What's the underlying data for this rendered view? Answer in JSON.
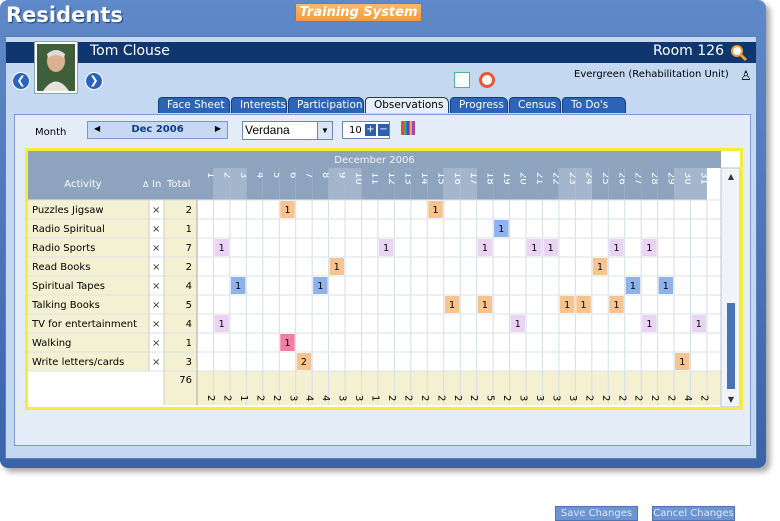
{
  "app": {
    "title": "Residents",
    "badge": "Training System"
  },
  "resident": {
    "name": "Tom Clouse",
    "room": "Room 126",
    "unit": "Evergreen (Rehabilitation Unit)"
  },
  "tabs": [
    "Face Sheet",
    "Interests",
    "Participation",
    "Observations",
    "Progress",
    "Census",
    "To Do's"
  ],
  "active_tab": "Observations",
  "controls": {
    "month_label": "Month",
    "month_value": "Dec 2006",
    "font": "Verdana",
    "size": "10"
  },
  "grid": {
    "banner": "December 2006",
    "col_activity": "Activity",
    "col_in": "In",
    "col_total": "Total",
    "days": [
      "1",
      "2",
      "3",
      "4",
      "5",
      "6",
      "7",
      "8",
      "9",
      "10",
      "11",
      "12",
      "13",
      "14",
      "15",
      "16",
      "17",
      "18",
      "19",
      "20",
      "21",
      "22",
      "23",
      "24",
      "25",
      "26",
      "27",
      "28",
      "29",
      "30",
      "31"
    ],
    "shaded_days": [
      2,
      3,
      9,
      10,
      16,
      17,
      23,
      24,
      30,
      31
    ],
    "rows": [
      {
        "activity": "Puzzles Jigsaw",
        "in": "×",
        "total": "2",
        "cells": [
          [
            6,
            "1",
            "#f6c48e"
          ],
          [
            15,
            "1",
            "#f6c48e"
          ]
        ]
      },
      {
        "activity": "Radio Spiritual",
        "in": "×",
        "total": "1",
        "cells": [
          [
            19,
            "1",
            "#8eb3ec"
          ]
        ]
      },
      {
        "activity": "Radio Sports",
        "in": "×",
        "total": "7",
        "cells": [
          [
            2,
            "1",
            "#ead4f4"
          ],
          [
            12,
            "1",
            "#ead4f4"
          ],
          [
            18,
            "1",
            "#ead4f4"
          ],
          [
            21,
            "1",
            "#ead4f4"
          ],
          [
            22,
            "1",
            "#ead4f4"
          ],
          [
            26,
            "1",
            "#ead4f4"
          ],
          [
            28,
            "1",
            "#ead4f4"
          ]
        ]
      },
      {
        "activity": "Read Books",
        "in": "×",
        "total": "2",
        "cells": [
          [
            9,
            "1",
            "#f6c48e"
          ],
          [
            25,
            "1",
            "#f6c48e"
          ]
        ]
      },
      {
        "activity": "Spiritual Tapes",
        "in": "×",
        "total": "4",
        "cells": [
          [
            3,
            "1",
            "#8eb3ec"
          ],
          [
            8,
            "1",
            "#8eb3ec"
          ],
          [
            27,
            "1",
            "#8eb3ec"
          ],
          [
            29,
            "1",
            "#8eb3ec"
          ]
        ]
      },
      {
        "activity": "Talking Books",
        "in": "×",
        "total": "5",
        "cells": [
          [
            16,
            "1",
            "#f6c48e"
          ],
          [
            18,
            "1",
            "#f6c48e"
          ],
          [
            23,
            "1",
            "#f6c48e"
          ],
          [
            24,
            "1",
            "#f6c48e"
          ],
          [
            26,
            "1",
            "#f6c48e"
          ]
        ]
      },
      {
        "activity": "TV for entertainment",
        "in": "×",
        "total": "4",
        "cells": [
          [
            2,
            "1",
            "#ead4f4"
          ],
          [
            20,
            "1",
            "#ead4f4"
          ],
          [
            28,
            "1",
            "#ead4f4"
          ],
          [
            31,
            "1",
            "#ead4f4"
          ]
        ]
      },
      {
        "activity": "Walking",
        "in": "×",
        "total": "1",
        "cells": [
          [
            6,
            "1",
            "#f27ea6"
          ]
        ]
      },
      {
        "activity": "Write letters/cards",
        "in": "×",
        "total": "3",
        "cells": [
          [
            7,
            "2",
            "#f6c48e"
          ],
          [
            30,
            "1",
            "#f6c48e"
          ]
        ]
      }
    ],
    "grand_total": "76",
    "day_totals": [
      "2",
      "2",
      "1",
      "2",
      "2",
      "3",
      "4",
      "4",
      "3",
      "3",
      "1",
      "2",
      "2",
      "2",
      "2",
      "2",
      "2",
      "5",
      "2",
      "3",
      "3",
      "3",
      "3",
      "2",
      "2",
      "2",
      "2",
      "2",
      "2",
      "4",
      "2"
    ]
  },
  "buttons": {
    "save": "Save Changes",
    "cancel": "Cancel Changes"
  }
}
